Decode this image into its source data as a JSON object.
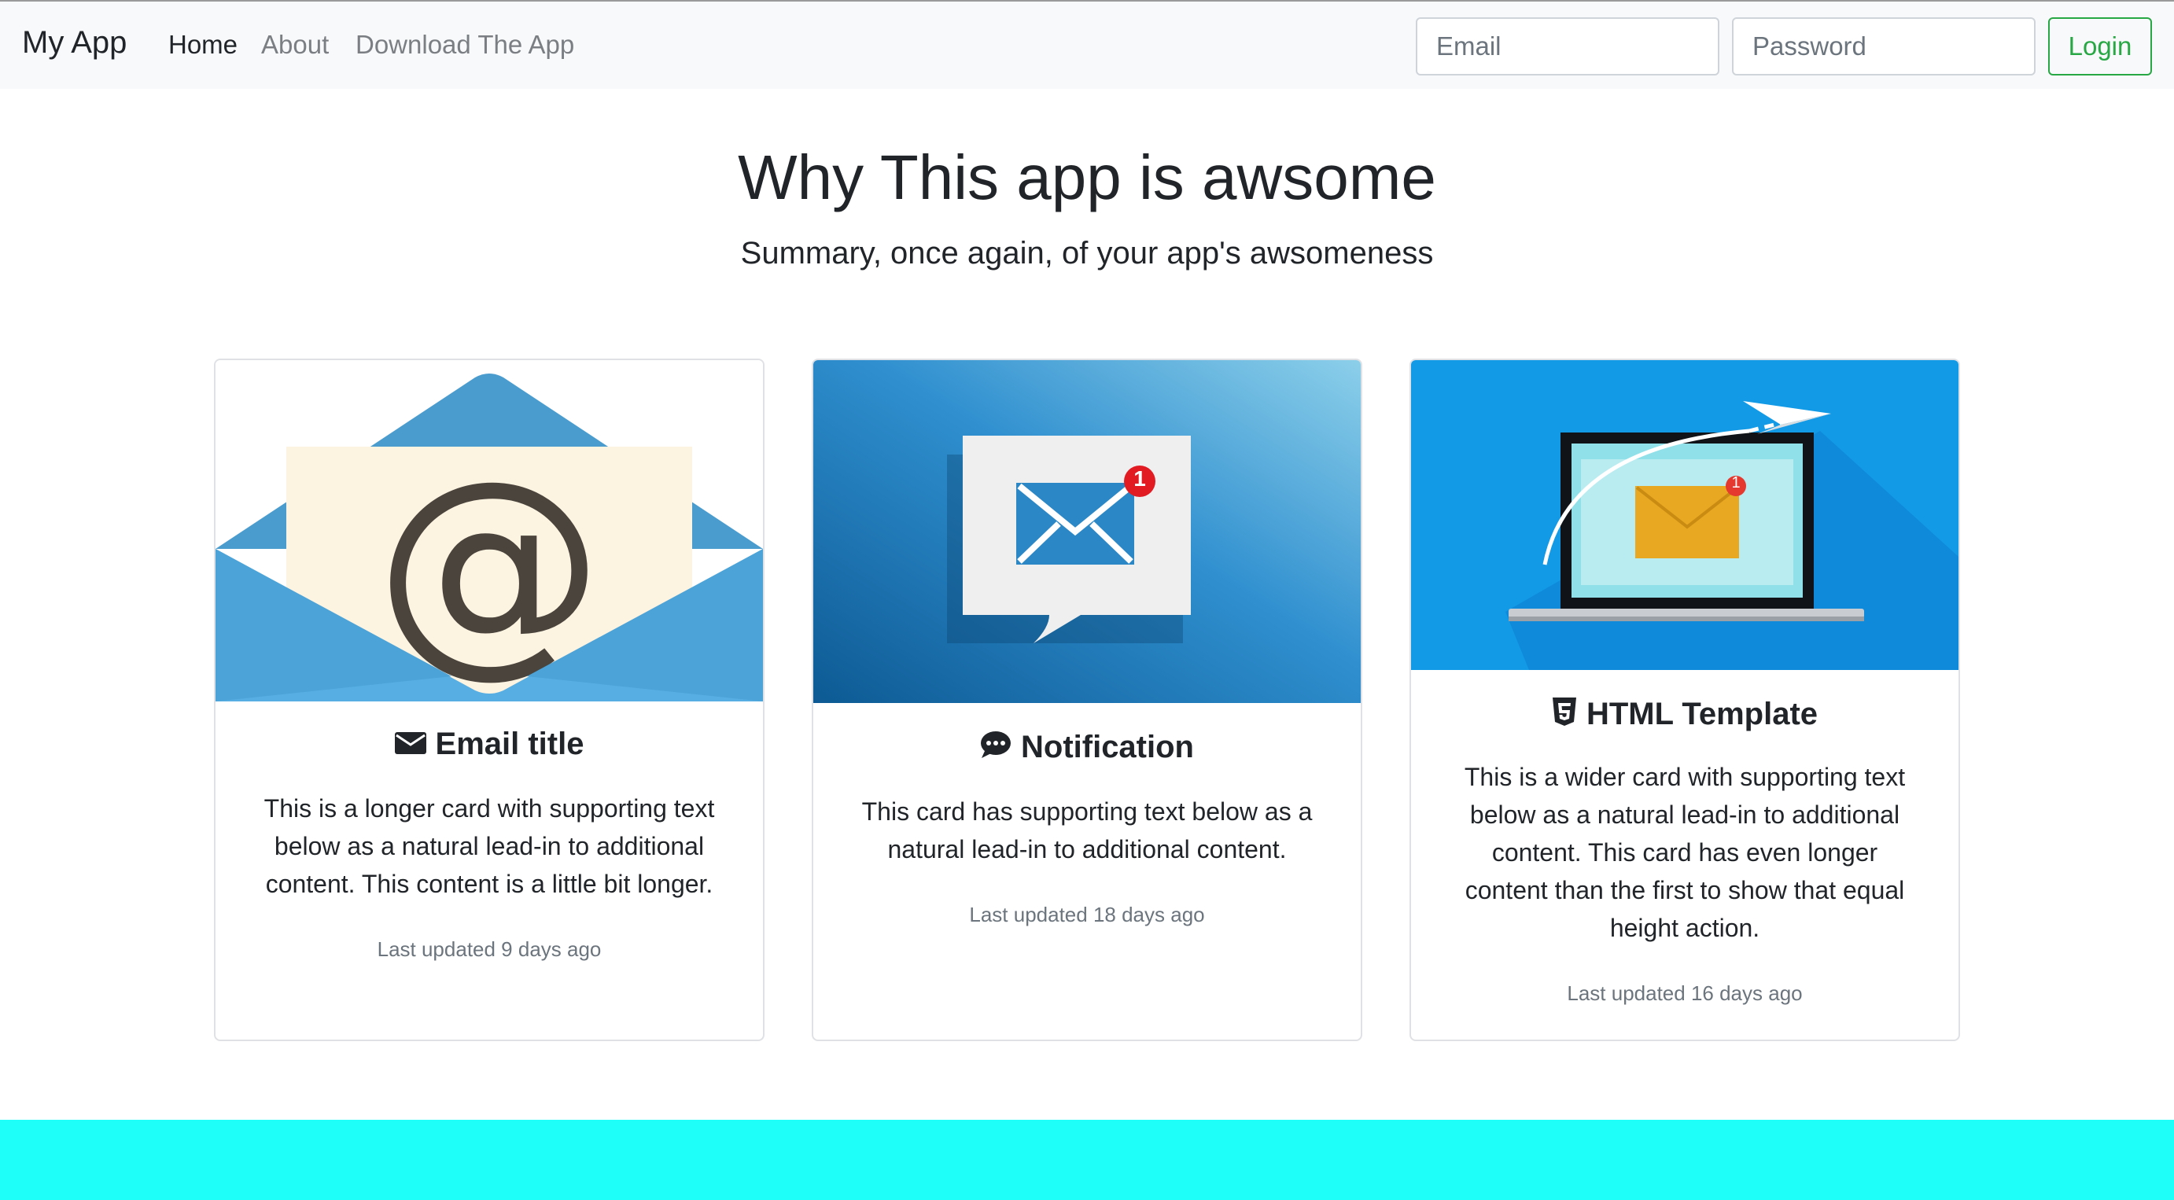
{
  "nav": {
    "brand": "My App",
    "links": [
      {
        "label": "Home",
        "active": true
      },
      {
        "label": "About",
        "active": false
      },
      {
        "label": "Download The App",
        "active": false
      }
    ],
    "email_placeholder": "Email",
    "password_placeholder": "Password",
    "login_label": "Login"
  },
  "hero": {
    "title": "Why This app is awsome",
    "subtitle": "Summary, once again, of your app's awsomeness"
  },
  "cards": [
    {
      "icon": "envelope-icon",
      "title": "Email title",
      "text": "This is a longer card with supporting text below as a natural lead-in to additional content. This content is a little bit longer.",
      "updated": "Last updated 9 days ago",
      "image_badge": ""
    },
    {
      "icon": "comment-dots-icon",
      "title": "Notification",
      "text": "This card has supporting text below as a natural lead-in to additional content.",
      "updated": "Last updated 18 days ago",
      "image_badge": "1"
    },
    {
      "icon": "html5-icon",
      "title": "HTML Template",
      "text": "This is a wider card with supporting text below as a natural lead-in to additional content. This card has even longer content than the first to show that equal height action.",
      "updated": "Last updated 16 days ago",
      "image_badge": "1"
    }
  ],
  "colors": {
    "navbar_bg": "#f8f9fa",
    "login_accent": "#28a745",
    "footer_band": "#1ffff9",
    "text": "#212529",
    "muted": "#6c757d"
  }
}
